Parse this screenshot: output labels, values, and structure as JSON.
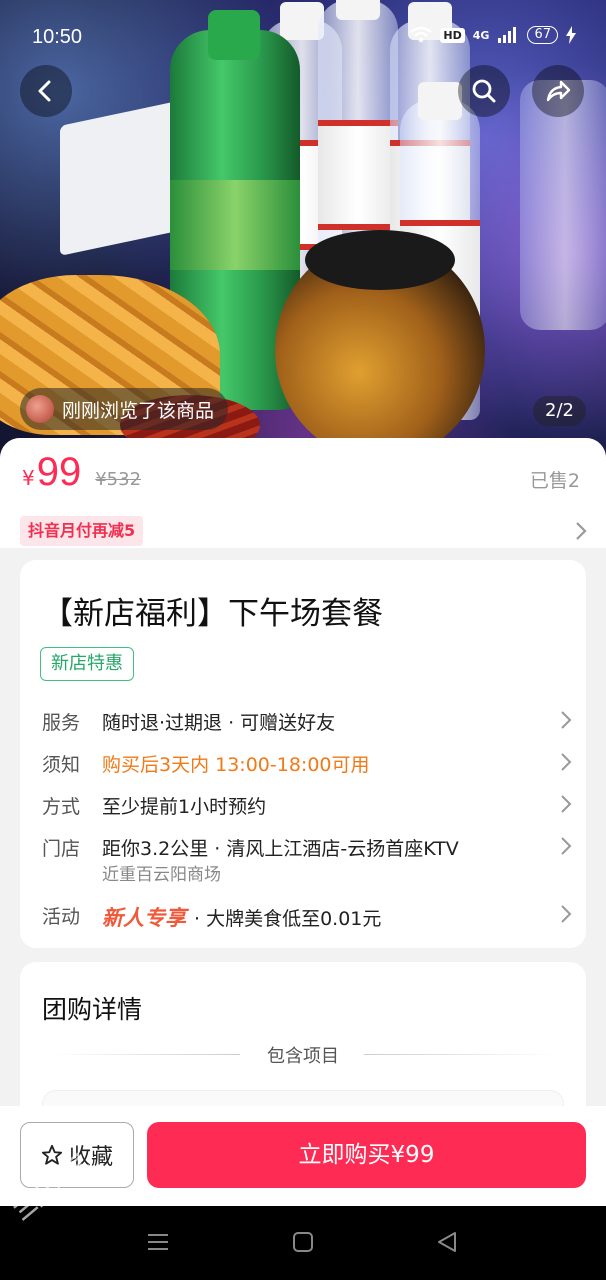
{
  "status_bar": {
    "time": "10:50",
    "network": "4G",
    "battery": "67",
    "hd": "HD"
  },
  "hero": {
    "browsed_text": "刚刚浏览了该商品",
    "pager": "2/2"
  },
  "price": {
    "currency": "¥",
    "current": "99",
    "original": "¥532",
    "sold": "已售2",
    "promo": "抖音月付再减5"
  },
  "product": {
    "title": "【新店福利】下午场套餐",
    "tag": "新店特惠",
    "rows": [
      {
        "key": "服务",
        "value": "随时退·过期退 · 可赠送好友"
      },
      {
        "key": "须知",
        "value": "购买后3天内 13:00-18:00可用"
      },
      {
        "key": "方式",
        "value": "至少提前1小时预约"
      },
      {
        "key": "门店",
        "value": "距你3.2公里 · 清风上江酒店-云扬首座KTV",
        "sub": "近重百云阳商场"
      },
      {
        "key": "活动",
        "badge": "新人专享",
        "value": "· 大牌美食低至0.01元"
      }
    ]
  },
  "detail": {
    "heading": "团购详情",
    "section": "包含项目"
  },
  "actions": {
    "favorite": "收藏",
    "buy": "立即购买¥99"
  },
  "watermark": "三阳人家",
  "colors": {
    "accent": "#fe2c55",
    "orange_notice": "#f07a18",
    "tag_green": "#25a868"
  },
  "icons": [
    "back-arrow-icon",
    "search-icon",
    "share-icon",
    "star-icon",
    "chevron-right-icon",
    "menu-icon",
    "home-square-icon",
    "back-triangle-icon"
  ]
}
